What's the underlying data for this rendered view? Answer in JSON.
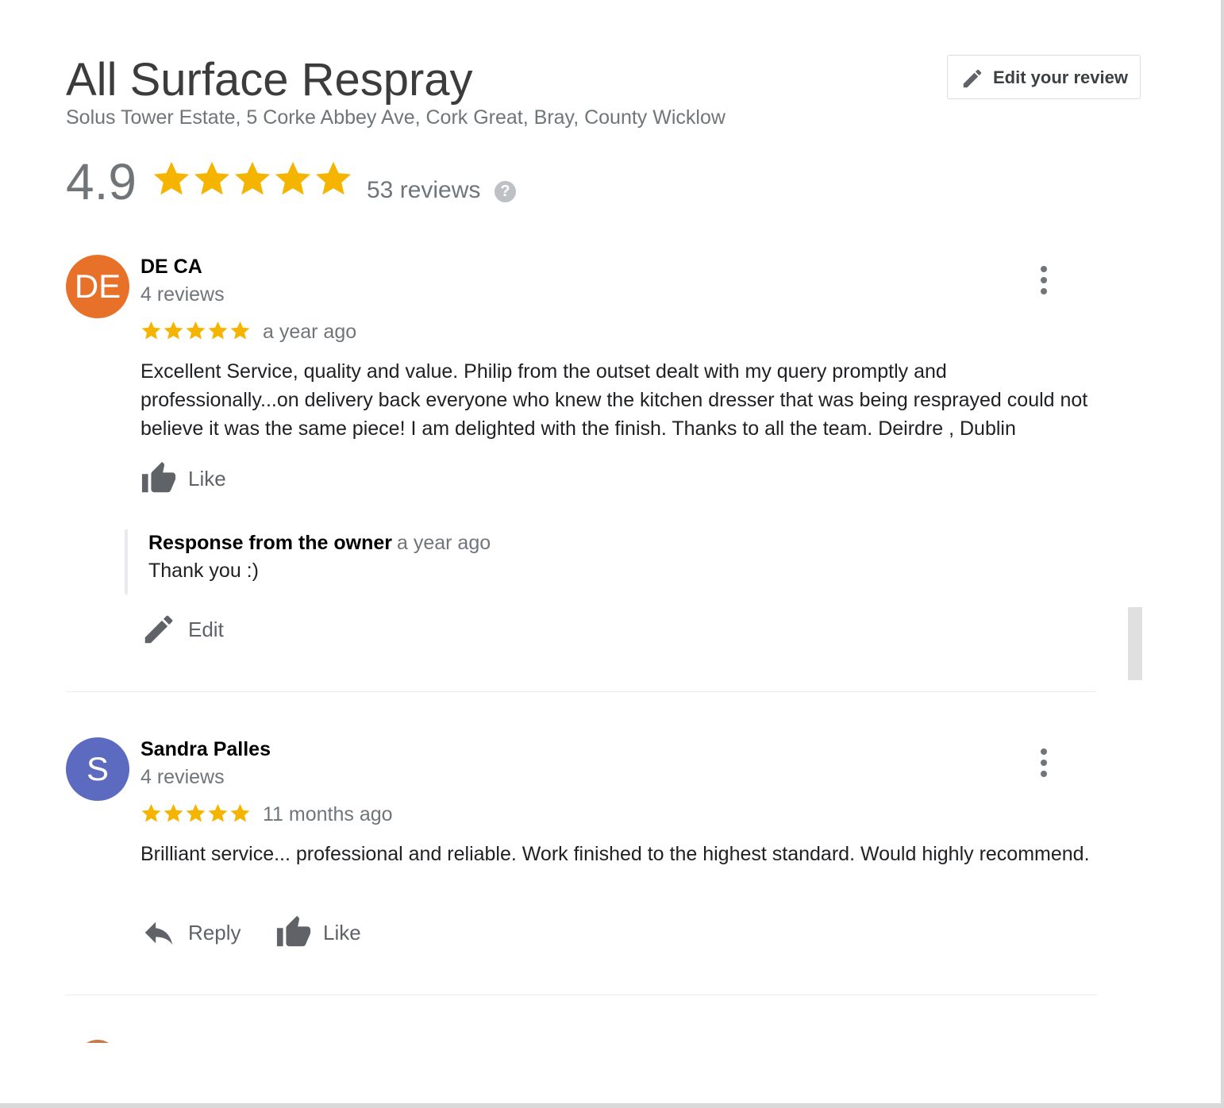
{
  "business": {
    "name": "All Surface Respray",
    "address": "Solus Tower Estate, 5 Corke Abbey Ave, Cork Great, Bray, County Wicklow"
  },
  "edit_review_button": {
    "label": "Edit your review",
    "icon": "pencil-icon"
  },
  "summary": {
    "rating": "4.9",
    "stars": 5,
    "review_count": "53 reviews",
    "help_icon": "?"
  },
  "colors": {
    "star": "#f4b400",
    "avatar_de": "#e8712a",
    "avatar_s": "#5c6bc0",
    "icon_gray": "#5f6368"
  },
  "reviews": [
    {
      "avatar_initials": "DE",
      "name": "DE CA",
      "review_count": "4 reviews",
      "stars": 5,
      "time": "a year ago",
      "text": "Excellent Service, quality and value. Philip from the outset dealt with my query promptly and professionally...on delivery back everyone who knew the kitchen dresser that was being resprayed could not believe it was the same piece! I am delighted with the finish. Thanks to all the team. Deirdre ,  Dublin",
      "like_label": "Like",
      "owner_response": {
        "label": "Response from the owner",
        "time": "a year ago",
        "text": "Thank you :)"
      },
      "edit_label": "Edit"
    },
    {
      "avatar_initials": "S",
      "name": "Sandra Palles",
      "review_count": "4 reviews",
      "stars": 5,
      "time": "11 months ago",
      "text": "Brilliant service... professional and reliable. Work finished to the highest standard. Would highly recommend.",
      "reply_label": "Reply",
      "like_label": "Like"
    }
  ]
}
